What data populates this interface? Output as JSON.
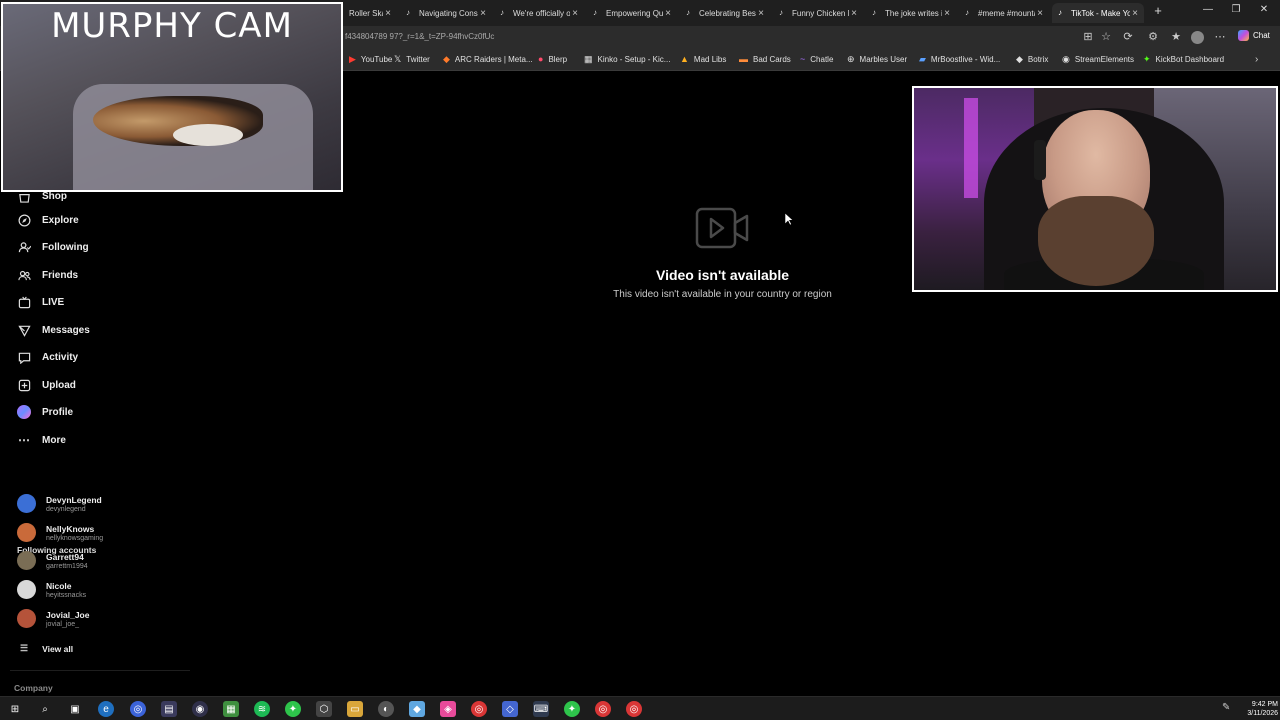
{
  "browser": {
    "tabs": [
      {
        "label": "Roller Skat",
        "icon": "tiktok-icon"
      },
      {
        "label": "Navigating Cons",
        "icon": "tiktok-icon"
      },
      {
        "label": "We're officially o",
        "icon": "tiktok-icon"
      },
      {
        "label": "Empowering Qui",
        "icon": "tiktok-icon"
      },
      {
        "label": "Celebrating Best",
        "icon": "tiktok-icon"
      },
      {
        "label": "Funny Chicken M",
        "icon": "tiktok-icon"
      },
      {
        "label": "The joke writes it",
        "icon": "tiktok-icon"
      },
      {
        "label": "#meme #mounta",
        "icon": "tiktok-icon"
      },
      {
        "label": "TikTok - Make Yo",
        "icon": "tiktok-icon"
      }
    ],
    "new_tab": "+",
    "url": "f434804789 97?_r=1&_t=ZP-94fhvCz0fUc",
    "chat_label": "Chat",
    "bookmarks": [
      {
        "label": "YouTube",
        "icon": "youtube-icon"
      },
      {
        "label": "Twitter",
        "icon": "x-icon"
      },
      {
        "label": "ARC Raiders | Meta...",
        "icon": "arc-icon"
      },
      {
        "label": "Blerp",
        "icon": "blerp-icon"
      },
      {
        "label": "Kinko - Setup - Kic...",
        "icon": "kinko-icon"
      },
      {
        "label": "Mad Libs",
        "icon": "madlibs-icon"
      },
      {
        "label": "Bad Cards",
        "icon": "cards-icon"
      },
      {
        "label": "Chatle",
        "icon": "twitch-icon"
      },
      {
        "label": "Marbles User",
        "icon": "globe-icon"
      },
      {
        "label": "MrBoostlive - Wid...",
        "icon": "boost-icon"
      },
      {
        "label": "Botrix",
        "icon": "botrix-icon"
      },
      {
        "label": "StreamElements",
        "icon": "streamelements-icon"
      },
      {
        "label": "KickBot Dashboard",
        "icon": "kick-icon"
      }
    ]
  },
  "overlay": {
    "murphy_cam_title": "MURPHY CAM"
  },
  "sidebar": {
    "nav": [
      {
        "label": "Shop",
        "icon": "shop-icon"
      },
      {
        "label": "Explore",
        "icon": "compass-icon"
      },
      {
        "label": "Following",
        "icon": "following-icon"
      },
      {
        "label": "Friends",
        "icon": "friends-icon"
      },
      {
        "label": "LIVE",
        "icon": "live-icon"
      },
      {
        "label": "Messages",
        "icon": "messages-icon"
      },
      {
        "label": "Activity",
        "icon": "activity-icon"
      },
      {
        "label": "Upload",
        "icon": "upload-icon"
      },
      {
        "label": "Profile",
        "icon": "profile-icon"
      },
      {
        "label": "More",
        "icon": "more-icon"
      }
    ],
    "following_heading": "Following accounts",
    "accounts": [
      {
        "name": "DevynLegend",
        "handle": "devynlegend",
        "color": "#3b6fd6"
      },
      {
        "name": "NellyKnows",
        "handle": "nellyknowsgaming",
        "color": "#c96a3a"
      },
      {
        "name": "Garrett94",
        "handle": "garrettm1994",
        "color": "#7a6d55"
      },
      {
        "name": "Nicole",
        "handle": "heyitssnacks",
        "color": "#d8d8d8"
      },
      {
        "name": "Jovial_Joe",
        "handle": "jovial_joe_",
        "color": "#b5533a"
      }
    ],
    "view_all": "View all",
    "company": "Company"
  },
  "main": {
    "video_title": "Video isn't available",
    "video_subtitle": "This video isn't available in your country or region"
  },
  "taskbar": {
    "time": "9:42 PM",
    "date": "3/11/2026"
  }
}
